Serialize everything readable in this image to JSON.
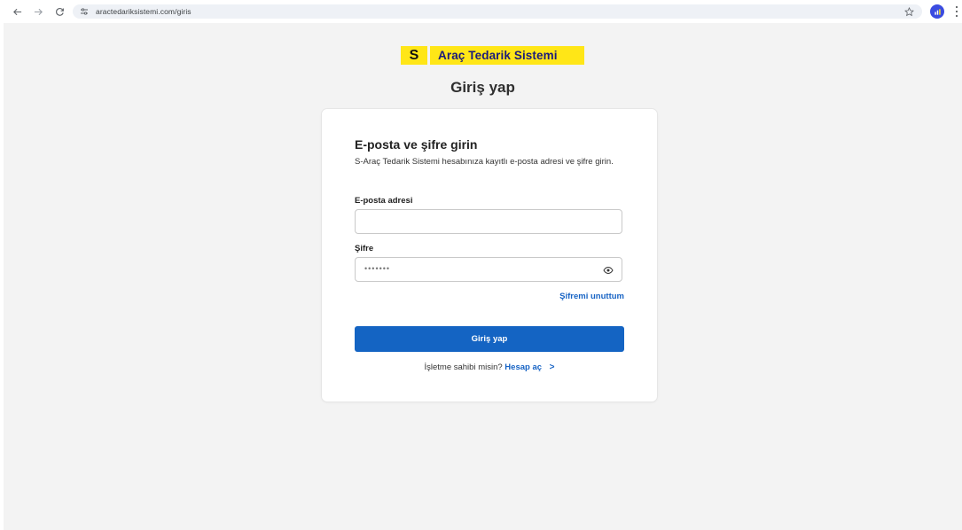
{
  "browser": {
    "url": "aractedariksistemi.com/giris",
    "profile_color": "#3b4ce0"
  },
  "brand": {
    "badge_letter": "S",
    "name": "Araç Tedarik Sistemi",
    "badge_color": "#ffe617"
  },
  "page": {
    "title": "Giriş yap"
  },
  "form": {
    "heading": "E-posta ve şifre girin",
    "description": "S-Araç Tedarik Sistemi hesabınıza kayıtlı e-posta adresi ve şifre girin.",
    "email_label": "E-posta adresi",
    "email_value": "",
    "password_label": "Şifre",
    "password_masked": "•••••••",
    "forgot_label": "Şifremi unuttum",
    "submit_label": "Giriş yap",
    "signup_prompt": "İşletme sahibi misin?",
    "signup_link": "Hesap aç",
    "primary_color": "#1464c3"
  },
  "icons": {
    "back": "arrow-left-icon",
    "forward": "arrow-right-icon",
    "reload": "reload-icon",
    "site_info": "tune-icon",
    "bookmark": "star-icon",
    "password_toggle": "eye-icon",
    "menu": "kebab-icon",
    "signup_chevron": "chevron-right-icon"
  }
}
